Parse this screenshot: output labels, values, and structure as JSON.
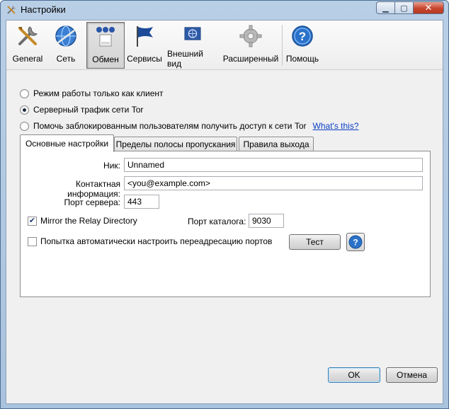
{
  "window": {
    "title": "Настройки"
  },
  "titlebar_buttons": {
    "minimize": "▁",
    "maximize": "▢",
    "close": "✕"
  },
  "toolbar": {
    "items": [
      {
        "label": "General",
        "icon": "tools-icon"
      },
      {
        "label": "Сеть",
        "icon": "network-globe-icon"
      },
      {
        "label": "Обмен",
        "icon": "sharing-icon",
        "active": true
      },
      {
        "label": "Сервисы",
        "icon": "flag-icon"
      },
      {
        "label": "Внешний вид",
        "icon": "appearance-flag-icon"
      },
      {
        "label": "Расширенный",
        "icon": "advanced-gear-icon"
      },
      {
        "label": "Помощь",
        "icon": "help-icon"
      }
    ]
  },
  "modes": {
    "client_only": "Режим работы только как клиент",
    "relay": "Серверный трафик сети Tor",
    "bridge": "Помочь заблокированным пользователям получить доступ к сети Tor",
    "whats_this": "What's this?",
    "selected": "relay"
  },
  "tabs": {
    "basic": "Основные настройки",
    "bandwidth": "Пределы полосы пропускания",
    "exit": "Правила выхода",
    "active": "basic"
  },
  "form": {
    "nick_label": "Ник:",
    "nick_value": "Unnamed",
    "contact_label": "Контактная информация:",
    "contact_value": "<you@example.com>",
    "port_label": "Порт сервера:",
    "port_value": "443",
    "mirror_label": "Mirror the Relay Directory",
    "mirror_checked": true,
    "dir_port_label": "Порт каталога:",
    "dir_port_value": "9030",
    "upnp_label": "Попытка автоматически настроить переадресацию портов",
    "upnp_checked": false,
    "test_button": "Тест",
    "help_glyph": "?"
  },
  "dialog": {
    "ok": "OK",
    "cancel": "Отмена"
  },
  "colors": {
    "frame": "#b9cfe6",
    "link": "#0a3fc7",
    "help_blue": "#2a72c9"
  }
}
